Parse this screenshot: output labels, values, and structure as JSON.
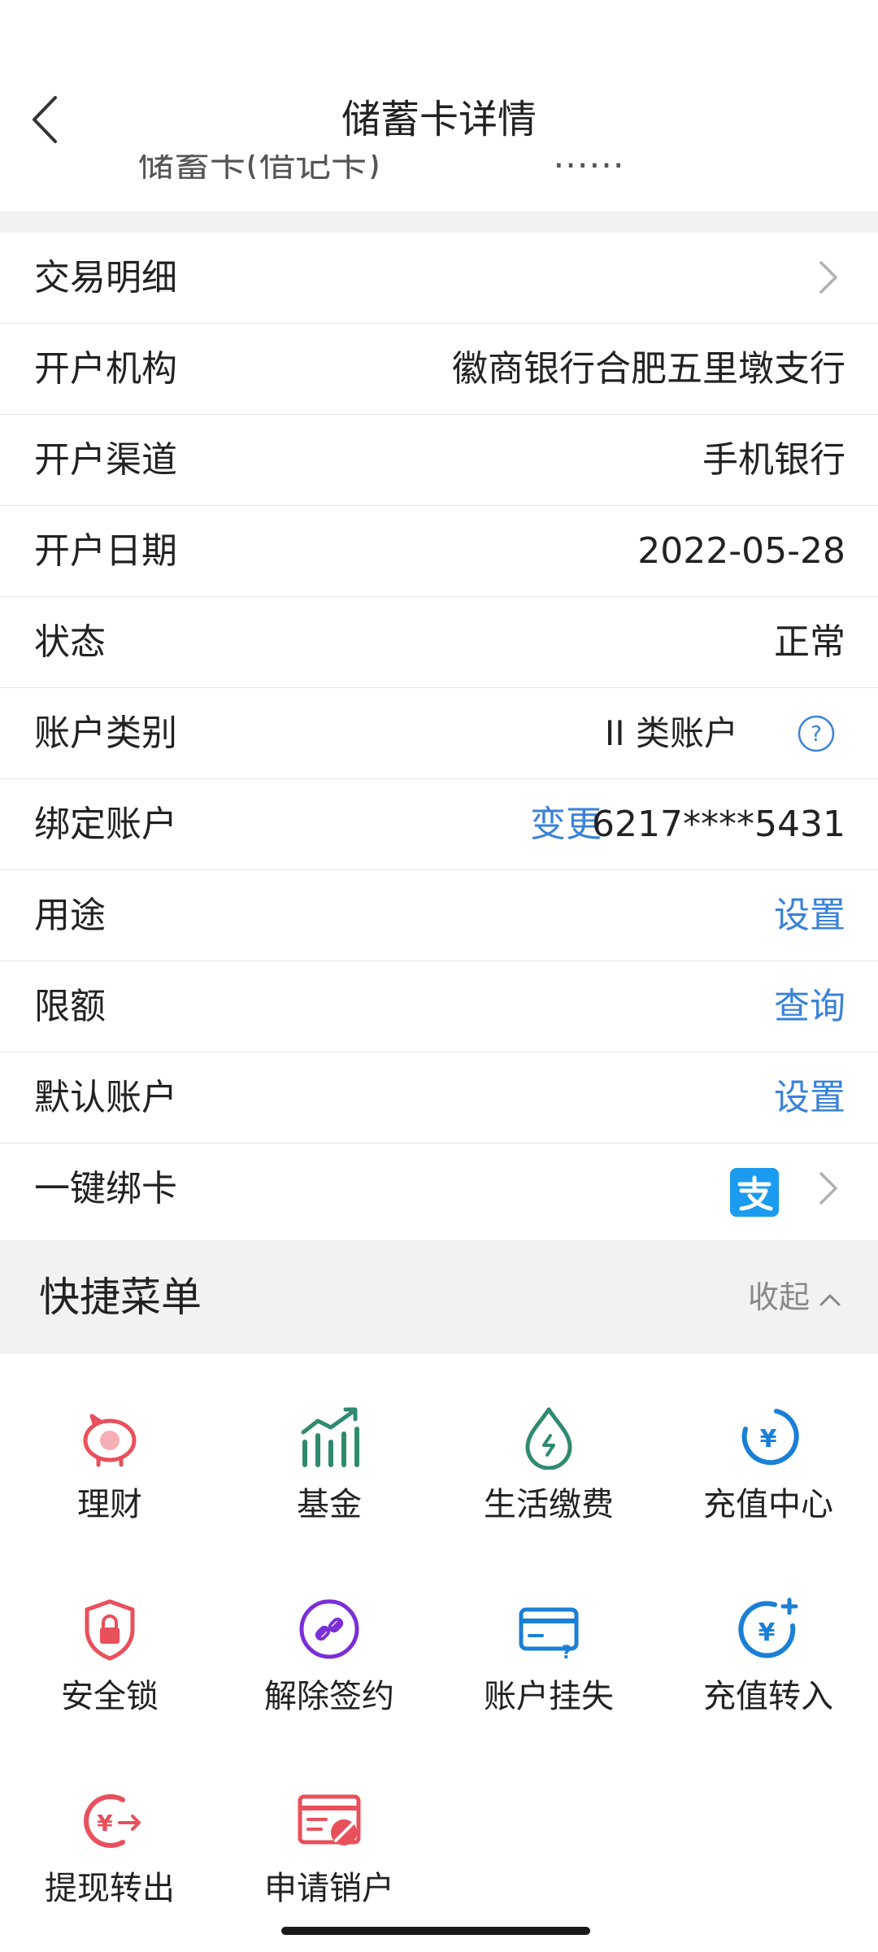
{
  "header": {
    "title": "储蓄卡详情"
  },
  "cutoff_text": [
    "储蓄卡(借记卡)",
    "……"
  ],
  "rows": [
    {
      "label": "交易明细",
      "value": ""
    },
    {
      "label": "开户机构",
      "value": "徽商银行合肥五里墩支行"
    },
    {
      "label": "开户渠道",
      "value": "手机银行"
    },
    {
      "label": "开户日期",
      "value": "2022-05-28"
    },
    {
      "label": "状态",
      "value": "正常"
    },
    {
      "label": "账户类别",
      "value": "II 类账户"
    },
    {
      "label": "绑定账户",
      "value": "6217****5431",
      "action": "变更"
    },
    {
      "label": "用途",
      "value": "设置"
    },
    {
      "label": "限额",
      "value": "查询"
    },
    {
      "label": "默认账户",
      "value": "设置"
    },
    {
      "label": "一键绑卡",
      "value": ""
    }
  ],
  "quick_menu": {
    "title": "快捷菜单",
    "collapse_label": "收起",
    "items": [
      {
        "label": "理财",
        "icon": "piggy-bank-icon"
      },
      {
        "label": "基金",
        "icon": "chart-icon"
      },
      {
        "label": "生活缴费",
        "icon": "drop-icon"
      },
      {
        "label": "充值中心",
        "icon": "yuan-circle-icon"
      },
      {
        "label": "安全锁",
        "icon": "shield-lock-icon"
      },
      {
        "label": "解除签约",
        "icon": "unlink-icon"
      },
      {
        "label": "账户挂失",
        "icon": "card-question-icon"
      },
      {
        "label": "充值转入",
        "icon": "yuan-plus-icon"
      },
      {
        "label": "提现转出",
        "icon": "yuan-out-icon"
      },
      {
        "label": "申请销户",
        "icon": "card-cancel-icon"
      }
    ]
  },
  "colors": {
    "accent_blue": "#3a82d8",
    "red": "#e8505b",
    "green": "#2f8a70",
    "purple": "#7b2fd6",
    "alipay": "#1b9bf0"
  }
}
